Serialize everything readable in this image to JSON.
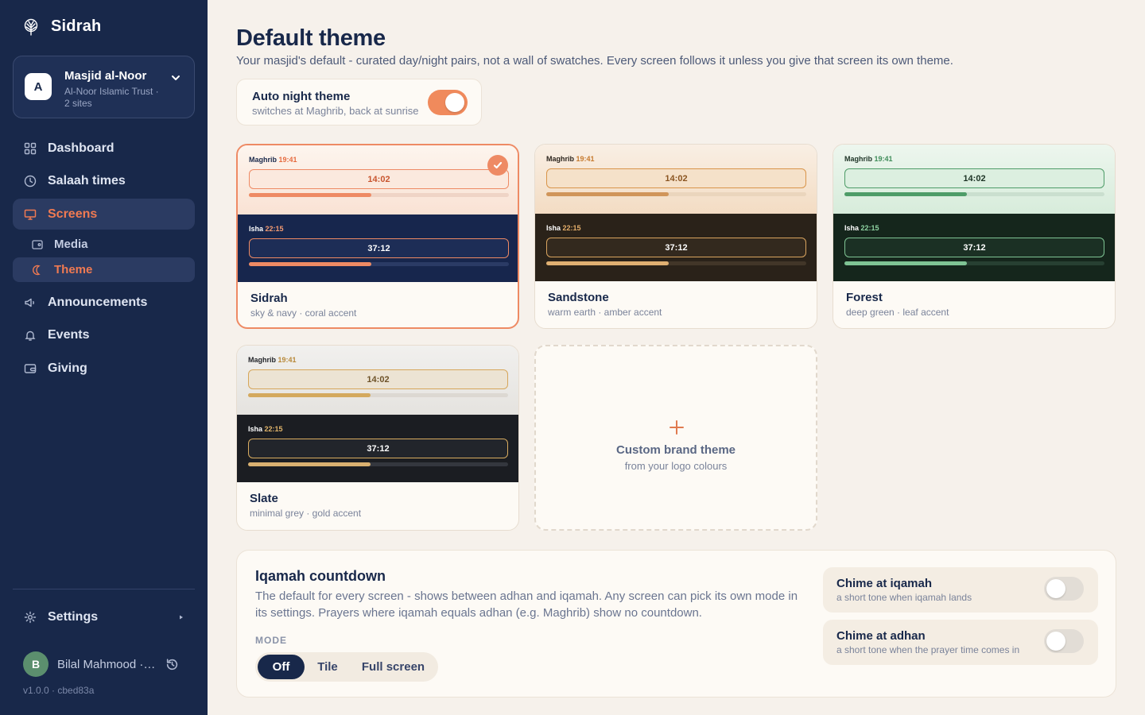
{
  "brand": {
    "name": "Sidrah"
  },
  "org": {
    "avatar_letter": "A",
    "name": "Masjid al-Noor",
    "subtitle": "Al-Noor Islamic Trust · 2 sites"
  },
  "nav": {
    "dashboard": "Dashboard",
    "salaah_times": "Salaah times",
    "screens": "Screens",
    "media": "Media",
    "theme": "Theme",
    "announcements": "Announcements",
    "events": "Events",
    "giving": "Giving",
    "settings": "Settings"
  },
  "user": {
    "avatar_letter": "B",
    "name": "Bilal Mahmood · a..."
  },
  "version": "v1.0.0 · cbed83a",
  "page": {
    "title": "Default theme",
    "description": "Your masjid's default - curated day/night pairs, not a wall of swatches. Every screen follows it unless you give that screen its own theme."
  },
  "auto_night": {
    "title": "Auto night theme",
    "subtitle": "switches at Maghrib, back at sunrise",
    "enabled": true
  },
  "preview": {
    "day_label": "Maghrib",
    "day_time": "19:41",
    "day_countdown": "14:02",
    "night_label": "Isha",
    "night_time": "22:15",
    "night_countdown": "37:12",
    "progress_fraction": 0.47
  },
  "themes": [
    {
      "name": "Sidrah",
      "subtitle": "sky & navy · coral accent",
      "selected": true
    },
    {
      "name": "Sandstone",
      "subtitle": "warm earth · amber accent",
      "selected": false
    },
    {
      "name": "Forest",
      "subtitle": "deep green · leaf accent",
      "selected": false
    },
    {
      "name": "Slate",
      "subtitle": "minimal grey · gold accent",
      "selected": false
    }
  ],
  "custom_theme": {
    "plus": "+",
    "title": "Custom brand theme",
    "subtitle": "from your logo colours"
  },
  "iqamah": {
    "title": "Iqamah countdown",
    "description": "The default for every screen - shows between adhan and iqamah. Any screen can pick its own mode in its settings. Prayers where iqamah equals adhan (e.g. Maghrib) show no countdown.",
    "mode_label": "MODE",
    "modes": [
      "Off",
      "Tile",
      "Full screen"
    ],
    "selected_mode": "Off",
    "chime_iqamah": {
      "title": "Chime at iqamah",
      "subtitle": "a short tone when iqamah lands",
      "enabled": false
    },
    "chime_adhan": {
      "title": "Chime at adhan",
      "subtitle": "a short tone when the prayer time comes in",
      "enabled": false
    }
  },
  "colors": {
    "sidebar_bg": "#18284a",
    "accent": "#f07a52",
    "page_bg": "#f6f1eb"
  }
}
